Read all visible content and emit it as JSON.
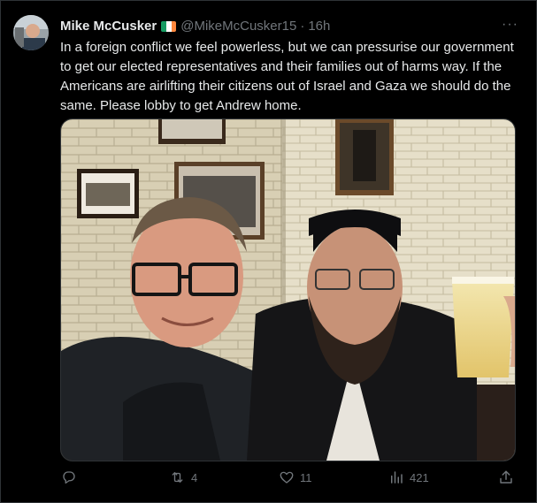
{
  "tweet": {
    "author_name": "Mike McCusker",
    "handle": "@MikeMcCusker15",
    "separator": "·",
    "time": "16h",
    "more": "···",
    "text": "In a foreign conflict we  feel powerless, but we can pressurise our government to get our elected representatives and their families out of harms way.  If the Americans are airlifting their citizens out of Israel and Gaza we should do the same.  Please lobby to get Andrew home.",
    "flag_colors": [
      "#169b62",
      "#ffffff",
      "#ff883e"
    ]
  },
  "actions": {
    "replies": "",
    "retweets": "4",
    "likes": "11",
    "views": "421"
  },
  "colors": {
    "background": "#000000",
    "text": "#e7e9ea",
    "muted": "#71767b",
    "border": "#2f3336"
  }
}
